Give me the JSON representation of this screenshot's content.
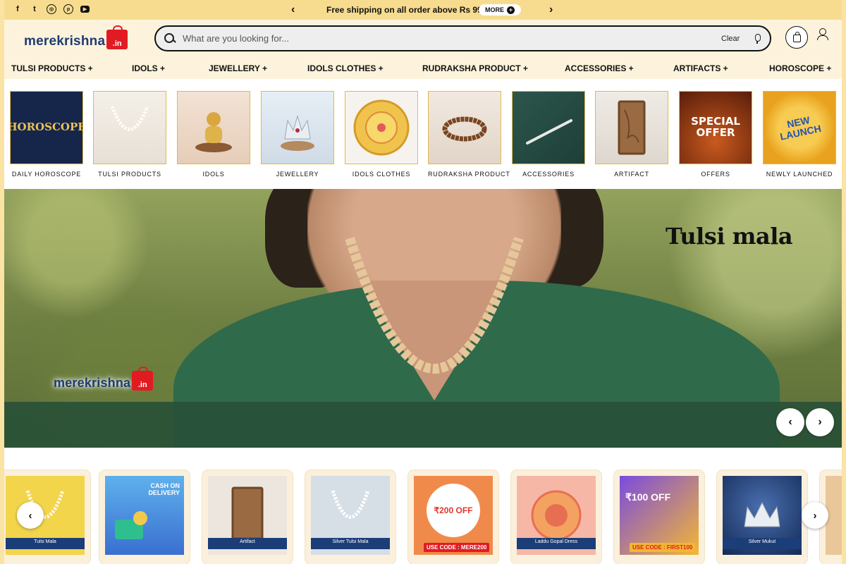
{
  "announcement": {
    "text": "Free shipping on all order above Rs 999 *",
    "more_label": "MORE",
    "prev_arrow": "‹",
    "next_arrow": "›"
  },
  "social": [
    {
      "name": "facebook-icon",
      "glyph": "f"
    },
    {
      "name": "twitter-icon",
      "glyph": "t"
    },
    {
      "name": "instagram-icon",
      "glyph": "◎"
    },
    {
      "name": "pinterest-icon",
      "glyph": "p"
    },
    {
      "name": "youtube-icon",
      "glyph": "▶"
    }
  ],
  "logo": {
    "text": "merekrishna",
    "suffix": ".in"
  },
  "search": {
    "placeholder": "What are you looking for...",
    "clear_label": "Clear"
  },
  "nav": [
    "TULSI PRODUCTS +",
    "IDOLS +",
    "JEWELLERY +",
    "IDOLS CLOTHES +",
    "RUDRAKSHA PRODUCT +",
    "ACCESSORIES +",
    "ARTIFACTS +",
    "HOROSCOPE +"
  ],
  "categories": [
    {
      "label": "DAILY HOROSCOPE",
      "thumb_text": "HOROSCOPE",
      "bg": "#16254a",
      "fg": "#e9c25a"
    },
    {
      "label": "TULSI PRODUCTS",
      "thumb_text": "",
      "bg": "#f2ede6",
      "fg": "#111"
    },
    {
      "label": "IDOLS",
      "thumb_text": "",
      "bg": "#f1ded0",
      "fg": "#111"
    },
    {
      "label": "JEWELLERY",
      "thumb_text": "",
      "bg": "#dbe6f0",
      "fg": "#111"
    },
    {
      "label": "IDOLS CLOTHES",
      "thumb_text": "",
      "bg": "#f6f3ee",
      "fg": "#111"
    },
    {
      "label": "RUDRAKSHA PRODUCT",
      "thumb_text": "",
      "bg": "#ede4dc",
      "fg": "#111"
    },
    {
      "label": "ACCESSORIES",
      "thumb_text": "",
      "bg": "#254b43",
      "fg": "#fff"
    },
    {
      "label": "ARTIFACT",
      "thumb_text": "",
      "bg": "#e9e5df",
      "fg": "#111"
    },
    {
      "label": "OFFERS",
      "thumb_text": "SPECIAL OFFER",
      "bg": "#7a2a10",
      "fg": "#ffffff"
    },
    {
      "label": "NEWLY LAUNCHED",
      "thumb_text": "NEW LAUNCH",
      "bg": "#f3b733",
      "fg": "#2453b4"
    }
  ],
  "hero": {
    "title": "Tulsi mala",
    "logo_text": "merekrishna",
    "logo_suffix": ".in",
    "prev_arrow": "‹",
    "next_arrow": "›"
  },
  "products": [
    {
      "name": "Tulsi Mala",
      "bg": "#f2d54a",
      "type": "plain",
      "text": ""
    },
    {
      "name": "",
      "bg": "#3e8fd8",
      "type": "cod",
      "text": "CASH ON DELIVERY"
    },
    {
      "name": "Artifact",
      "bg": "#e9e2da",
      "type": "plain",
      "text": ""
    },
    {
      "name": "Silver Tulsi Mala",
      "bg": "#cfd8e2",
      "type": "plain",
      "text": ""
    },
    {
      "name": "",
      "bg": "#f08a4a",
      "type": "offer",
      "text": "₹200 OFF",
      "code": "USE CODE : MERE200"
    },
    {
      "name": "Laddu Gopal Dress",
      "bg": "#f7b7a6",
      "type": "plain",
      "text": ""
    },
    {
      "name": "",
      "bg": "#6b3fd6",
      "type": "offer",
      "text": "₹100 OFF",
      "code": "USE CODE : FIRST100"
    },
    {
      "name": "Silver Mukut",
      "bg": "#21427a",
      "type": "plain",
      "text": ""
    },
    {
      "name": "",
      "bg": "#e9c79a",
      "type": "plain",
      "text": ""
    }
  ],
  "product_arrows": {
    "prev": "‹",
    "next": "›"
  }
}
